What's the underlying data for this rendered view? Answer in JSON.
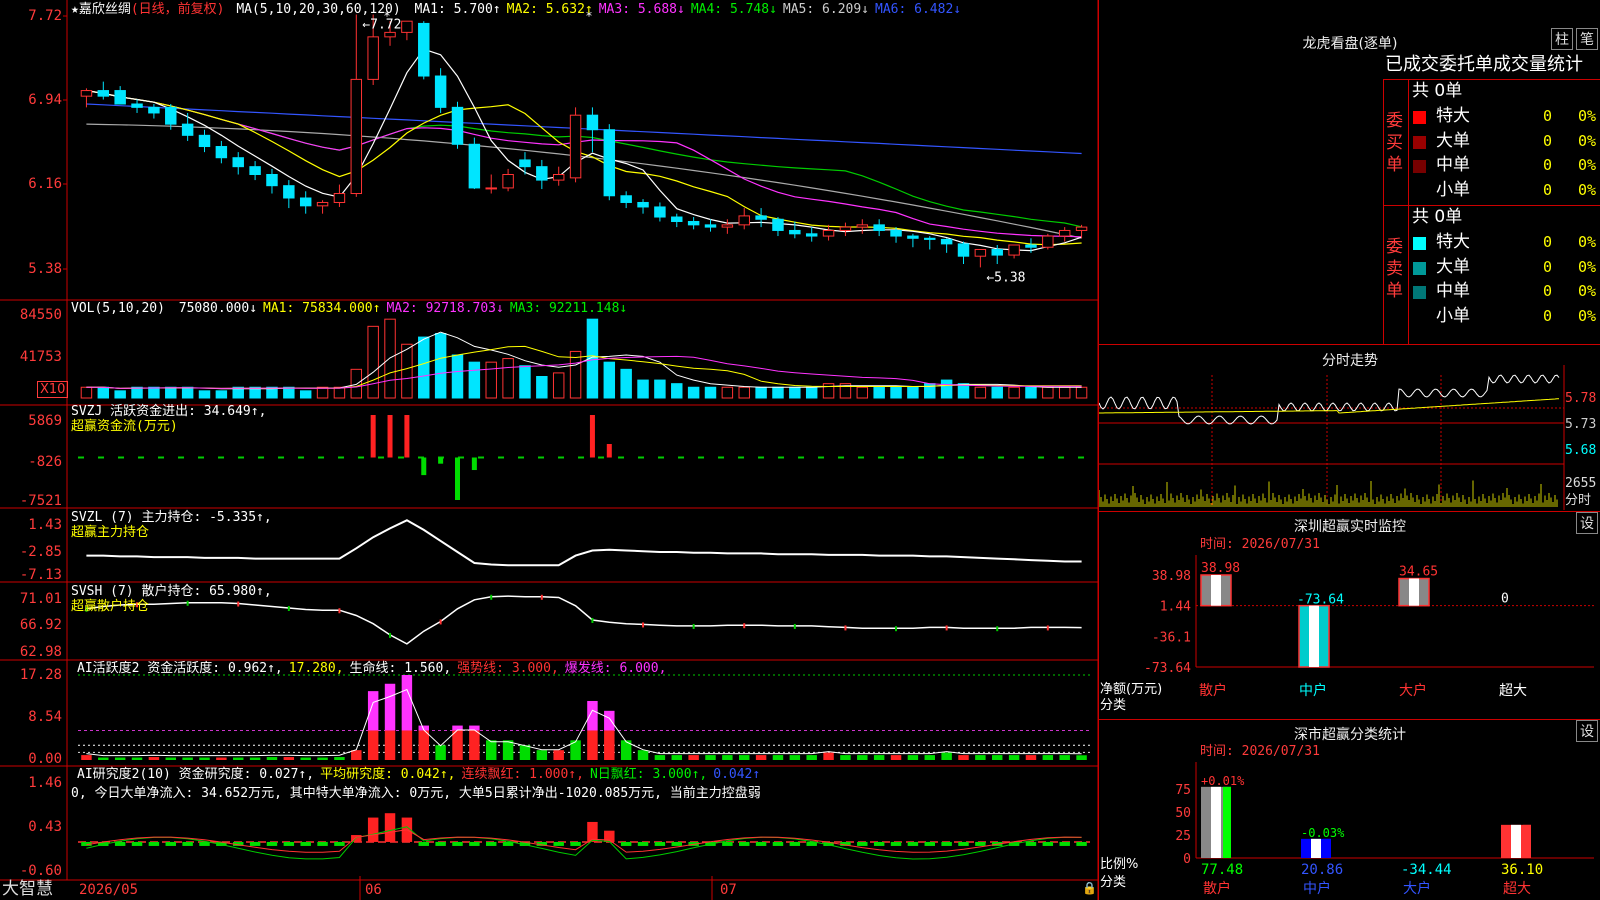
{
  "stock": {
    "star": "★",
    "name": "嘉欣丝绸",
    "mode": "(日线，前复权)"
  },
  "ma_header": {
    "label": "MA(5,10,20,30,60,120)",
    "items": [
      {
        "t": "MA1: 5.700↑",
        "c": "#ffffff"
      },
      {
        "t": "MA2: 5.632↑",
        "c": "#ffff00"
      },
      {
        "t": "MA3: 5.688↓",
        "c": "#ff33ff"
      },
      {
        "t": "MA4: 5.748↓",
        "c": "#00ee00"
      },
      {
        "t": "MA5: 6.209↓",
        "c": "#cccccc"
      },
      {
        "t": "MA6: 6.482↓",
        "c": "#3355ff"
      }
    ]
  },
  "price_axis": {
    "labels": [
      "7.72",
      "6.94",
      "6.16",
      "5.38"
    ]
  },
  "price_annot": {
    "high": "7.72",
    "low": "5.38"
  },
  "vol_header": {
    "label": "VOL(5,10,20)",
    "items": [
      {
        "t": "75080.000↓",
        "c": "#ffffff"
      },
      {
        "t": "MA1: 75834.000↑",
        "c": "#ffff00"
      },
      {
        "t": "MA2: 92718.703↓",
        "c": "#ff33ff"
      },
      {
        "t": "MA3: 92211.148↓",
        "c": "#00ee00"
      }
    ]
  },
  "vol_axis": {
    "labels": [
      "84550",
      "41753"
    ],
    "unit": "X10"
  },
  "svzj": {
    "header": "SVZJ  活跃资金进出: 34.649↑,",
    "sub": "超赢资金流(万元)",
    "axis": [
      "5869",
      "-826",
      "-7521"
    ]
  },
  "svzl": {
    "header": "SVZL (7) 主力持仓: -5.335↑,",
    "sub": "超赢主力持仓",
    "axis": [
      "1.43",
      "-2.85",
      "-7.13"
    ]
  },
  "svsh": {
    "header": "SVSH (7) 散户持仓: 65.980↑,",
    "sub": "超赢散户持仓",
    "axis": [
      "71.01",
      "66.92",
      "62.98"
    ]
  },
  "ai1": {
    "items": [
      {
        "t": "AI活跃度2 资金活跃度: 0.962↑,",
        "c": "#ffffff"
      },
      {
        "t": "17.280,",
        "c": "#ffff00"
      },
      {
        "t": "生命线: 1.560,",
        "c": "#ffffff"
      },
      {
        "t": "强势线: 3.000,",
        "c": "#ff3333"
      },
      {
        "t": "爆发线: 6.000,",
        "c": "#ff33ff"
      }
    ],
    "axis": [
      "17.28",
      "8.54",
      "0.00"
    ]
  },
  "ai2": {
    "items": [
      {
        "t": "AI研究度2(10) 资金研究度: 0.027↑,",
        "c": "#ffffff"
      },
      {
        "t": "平均研究度: 0.042↑,",
        "c": "#ffff00"
      },
      {
        "t": "连续飘红: 1.000↑,",
        "c": "#ff3333"
      },
      {
        "t": "N日飘红: 3.000↑,",
        "c": "#00ee00"
      },
      {
        "t": "0.042↑",
        "c": "#3355ff"
      }
    ],
    "line2": "0, 今日大单净流入: 34.652万元, 其中特大单净流入: 0万元, 大单5日累计净出-1020.085万元, 当前主力控盘弱",
    "axis": [
      "1.46",
      "0.43",
      "-0.60"
    ]
  },
  "date_axis": {
    "brand": "大智慧",
    "labels": [
      "2026/05",
      "06",
      "07"
    ]
  },
  "longhu": {
    "title": "龙虎看盘(逐单)",
    "btn1": "柱",
    "btn2": "笔",
    "heading": "已成交委托单成交量统计",
    "buy": {
      "side": "委买单",
      "total": "共 0单",
      "rows": [
        {
          "name": "特大",
          "v": "0",
          "p": "0%",
          "c": "#ff0000"
        },
        {
          "name": "大单",
          "v": "0",
          "p": "0%",
          "c": "#990000"
        },
        {
          "name": "中单",
          "v": "0",
          "p": "0%",
          "c": "#770000"
        },
        {
          "name": "小单",
          "v": "0",
          "p": "0%",
          "c": "#000000"
        }
      ]
    },
    "sell": {
      "side": "委卖单",
      "total": "共 0单",
      "rows": [
        {
          "name": "特大",
          "v": "0",
          "p": "0%",
          "c": "#00ffff"
        },
        {
          "name": "大单",
          "v": "0",
          "p": "0%",
          "c": "#009999"
        },
        {
          "name": "中单",
          "v": "0",
          "p": "0%",
          "c": "#007777"
        },
        {
          "name": "小单",
          "v": "0",
          "p": "0%",
          "c": "#000000"
        }
      ]
    }
  },
  "fenshi": {
    "title": "分时走势",
    "price_axis": [
      "5.78",
      "5.73",
      "5.68"
    ],
    "vol_axis": [
      "2655",
      "分时"
    ]
  },
  "monitor": {
    "title": "深圳超赢实时监控",
    "set": "设",
    "time": "时间: 2026/07/31",
    "axis": [
      "38.98",
      "1.44",
      "-36.1",
      "-73.64"
    ],
    "unit": "净额(万元)",
    "cat_label": "分类",
    "categories": [
      "散户",
      "中户",
      "大户",
      "超大"
    ],
    "values": [
      38.98,
      -73.64,
      34.65,
      0
    ],
    "value_labels": [
      "38.98",
      "-73.64",
      "34.65",
      "0"
    ]
  },
  "classify": {
    "title": "深市超赢分类统计",
    "set": "设",
    "time": "时间: 2026/07/31",
    "axis": [
      "75",
      "50",
      "25",
      "0"
    ],
    "unit": "比例%",
    "cat_label": "分类",
    "categories": [
      "散户",
      "中户",
      "大户",
      "超大"
    ],
    "pcts": [
      77.48,
      20.86,
      -34.44,
      36.1
    ],
    "pct_labels": [
      "+0.01%",
      "-0.03%"
    ],
    "bottom_labels": [
      "77.48",
      "20.86",
      "-34.44",
      "36.10"
    ]
  },
  "chart_data": {
    "type": "candlestick",
    "price": {
      "open": [
        7.05,
        7.1,
        7.1,
        6.98,
        6.95,
        6.95,
        6.8,
        6.7,
        6.6,
        6.5,
        6.42,
        6.35,
        6.25,
        6.14,
        6.07,
        6.1,
        6.18,
        7.2,
        7.58,
        7.62,
        7.7,
        7.23,
        6.95,
        6.62,
        6.23,
        6.23,
        6.48,
        6.42,
        6.3,
        6.32,
        6.88,
        6.75,
        6.16,
        6.1,
        6.06,
        5.97,
        5.93,
        5.9,
        5.88,
        5.9,
        5.98,
        5.95,
        5.85,
        5.82,
        5.8,
        5.85,
        5.88,
        5.9,
        5.85,
        5.8,
        5.78,
        5.77,
        5.73,
        5.62,
        5.68,
        5.63,
        5.72,
        5.7,
        5.8,
        5.85
      ],
      "high": [
        7.12,
        7.18,
        7.14,
        7.02,
        6.98,
        6.98,
        6.9,
        6.75,
        6.65,
        6.55,
        6.47,
        6.4,
        6.3,
        6.2,
        6.12,
        6.26,
        7.78,
        7.78,
        7.72,
        7.72,
        7.72,
        7.3,
        7.0,
        6.68,
        6.35,
        6.4,
        6.55,
        6.48,
        6.42,
        6.95,
        6.95,
        6.8,
        6.2,
        6.13,
        6.1,
        6.0,
        5.97,
        5.95,
        5.95,
        6.05,
        6.05,
        5.97,
        5.93,
        5.88,
        5.9,
        5.92,
        5.95,
        5.95,
        5.88,
        5.82,
        5.8,
        5.78,
        5.75,
        5.68,
        5.72,
        5.7,
        5.78,
        5.82,
        5.88,
        5.9
      ],
      "low": [
        6.95,
        7.02,
        7.0,
        6.9,
        6.85,
        6.75,
        6.65,
        6.55,
        6.45,
        6.35,
        6.3,
        6.18,
        6.05,
        6.0,
        6.0,
        6.06,
        6.15,
        7.15,
        7.5,
        7.55,
        7.2,
        6.9,
        6.58,
        6.22,
        6.18,
        6.2,
        6.35,
        6.22,
        6.25,
        6.28,
        6.55,
        6.12,
        6.05,
        6.0,
        5.93,
        5.88,
        5.86,
        5.84,
        5.82,
        5.86,
        5.88,
        5.8,
        5.78,
        5.75,
        5.76,
        5.8,
        5.82,
        5.8,
        5.74,
        5.7,
        5.68,
        5.65,
        5.55,
        5.52,
        5.55,
        5.6,
        5.65,
        5.68,
        5.75,
        5.78
      ],
      "close": [
        7.1,
        7.05,
        6.98,
        6.95,
        6.9,
        6.8,
        6.7,
        6.6,
        6.5,
        6.42,
        6.35,
        6.25,
        6.14,
        6.07,
        6.1,
        6.18,
        7.2,
        7.58,
        7.62,
        7.72,
        7.23,
        6.95,
        6.62,
        6.23,
        6.23,
        6.35,
        6.42,
        6.3,
        6.35,
        6.88,
        6.75,
        6.16,
        6.1,
        6.06,
        5.97,
        5.93,
        5.9,
        5.88,
        5.9,
        5.98,
        5.95,
        5.85,
        5.82,
        5.8,
        5.85,
        5.88,
        5.9,
        5.85,
        5.8,
        5.78,
        5.77,
        5.73,
        5.62,
        5.68,
        5.63,
        5.72,
        5.7,
        5.8,
        5.85,
        5.88
      ]
    },
    "volume": [
      3,
      3,
      2,
      3,
      3,
      3,
      3,
      2,
      2,
      3,
      3,
      3,
      3,
      2,
      3,
      3,
      8,
      20,
      22,
      15,
      17,
      18,
      12,
      10,
      10,
      11,
      9,
      6,
      7,
      13,
      22,
      10,
      8,
      5,
      5,
      4,
      3,
      3,
      3,
      3,
      3,
      3,
      3,
      3,
      4,
      4,
      3,
      3,
      3,
      3,
      4,
      5,
      4,
      3,
      3,
      3,
      3,
      3,
      3,
      3
    ],
    "svzj": [
      0,
      0,
      0,
      0,
      0,
      0,
      0,
      0,
      0,
      0,
      0,
      0,
      0,
      0,
      0,
      0,
      0,
      5869,
      5869,
      5869,
      -3600,
      -1800,
      -7521,
      -2800,
      0,
      0,
      0,
      0,
      0,
      0,
      5869,
      1300,
      0,
      0,
      0,
      0,
      0,
      0,
      0,
      0,
      0,
      0,
      0,
      0,
      0,
      0,
      0,
      0,
      0,
      0,
      0,
      0,
      0,
      0,
      0,
      0,
      0,
      0,
      0,
      0
    ],
    "svzl": [
      -4.5,
      -4.5,
      -4.6,
      -4.6,
      -4.7,
      -4.7,
      -4.7,
      -4.8,
      -4.8,
      -4.8,
      -4.9,
      -4.9,
      -4.9,
      -4.9,
      -4.9,
      -4.9,
      -3.5,
      -2.0,
      -0.8,
      0.3,
      -1.0,
      -2.5,
      -4.0,
      -5.5,
      -5.7,
      -5.8,
      -5.8,
      -5.8,
      -5.8,
      -4.5,
      -3.8,
      -3.7,
      -3.8,
      -3.9,
      -4.0,
      -4.0,
      -4.1,
      -4.1,
      -4.2,
      -4.2,
      -4.2,
      -4.3,
      -4.3,
      -4.3,
      -4.4,
      -4.4,
      -4.4,
      -4.5,
      -4.5,
      -4.5,
      -4.6,
      -4.6,
      -4.7,
      -4.8,
      -4.9,
      -5.0,
      -5.1,
      -5.2,
      -5.3,
      -5.3
    ],
    "svsh": [
      68.5,
      68.8,
      69.0,
      69.1,
      69.1,
      69.2,
      69.3,
      69.3,
      69.3,
      69.2,
      69.0,
      68.8,
      68.6,
      68.4,
      68.3,
      68.3,
      67.6,
      66.5,
      65.0,
      63.8,
      65.5,
      66.8,
      68.5,
      69.7,
      70.1,
      70.2,
      70.1,
      70.1,
      70.0,
      68.9,
      67.0,
      66.7,
      66.5,
      66.4,
      66.3,
      66.2,
      66.2,
      66.2,
      66.3,
      66.3,
      66.3,
      66.2,
      66.2,
      66.2,
      66.1,
      66.0,
      65.9,
      65.9,
      65.9,
      65.9,
      66.0,
      66.0,
      65.9,
      65.9,
      65.9,
      65.9,
      66.0,
      66.0,
      66.0,
      65.98
    ],
    "ai1": [
      1,
      0.5,
      0.5,
      0.5,
      0.6,
      0.5,
      0.5,
      0.5,
      0.5,
      0.5,
      0.5,
      0.6,
      0.6,
      0.5,
      0.5,
      0.6,
      2,
      14,
      15.5,
      17.28,
      7,
      3,
      7,
      7,
      4,
      4,
      3,
      2,
      2,
      4,
      12,
      10,
      4,
      2,
      1,
      1,
      1,
      1,
      1,
      1,
      1,
      1,
      1,
      1,
      1.5,
      1,
      1,
      1,
      1,
      1,
      1,
      1.5,
      1,
      1,
      1,
      1,
      1,
      1,
      1,
      0.962
    ],
    "ai2": [
      0.03,
      0.02,
      0.02,
      0.02,
      0.03,
      0.02,
      0.02,
      0.02,
      0.02,
      0.02,
      0.02,
      0.03,
      0.03,
      0.02,
      0.02,
      0.03,
      0.2,
      0.6,
      0.7,
      0.6,
      0.1,
      0.05,
      0.1,
      0.1,
      0.05,
      0.03,
      0.03,
      0.02,
      0.02,
      0.05,
      0.5,
      0.3,
      0.05,
      0.03,
      0.02,
      0.02,
      0.02,
      0.02,
      0.02,
      0.02,
      0.02,
      0.02,
      0.02,
      0.02,
      0.03,
      0.02,
      0.02,
      0.02,
      0.02,
      0.02,
      0.02,
      0.03,
      0.02,
      0.02,
      0.02,
      0.02,
      0.02,
      0.02,
      0.02,
      0.027
    ]
  }
}
